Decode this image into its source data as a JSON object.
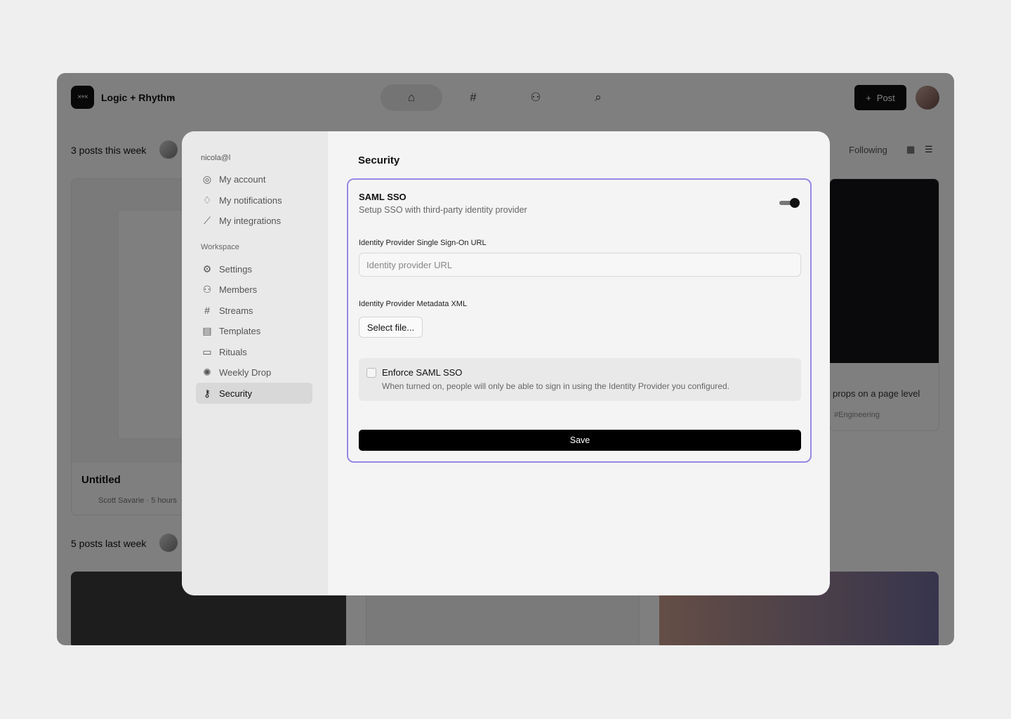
{
  "app": {
    "workspace_name": "Logic + Rhythm",
    "logo_glyph": "×+×",
    "post_button_label": "Post",
    "following_label": "Following",
    "this_week_heading": "3 posts this week",
    "last_week_heading": "5 posts last week",
    "card": {
      "title": "Untitled",
      "meta": "Scott Savarie · 5 hours"
    },
    "right_card": {
      "caption": "props on a page level",
      "tag": "#Engineering"
    }
  },
  "modal": {
    "user_email": "nicola@l",
    "account_items": [
      {
        "label": "My account",
        "icon": "user-circle-icon"
      },
      {
        "label": "My notifications",
        "icon": "bell-icon"
      },
      {
        "label": "My integrations",
        "icon": "plug-icon"
      }
    ],
    "workspace_section_label": "Workspace",
    "workspace_items": [
      {
        "label": "Settings",
        "icon": "gear-icon"
      },
      {
        "label": "Members",
        "icon": "people-icon"
      },
      {
        "label": "Streams",
        "icon": "hash-icon"
      },
      {
        "label": "Templates",
        "icon": "template-icon"
      },
      {
        "label": "Rituals",
        "icon": "calendar-icon"
      },
      {
        "label": "Weekly Drop",
        "icon": "badge-icon"
      },
      {
        "label": "Security",
        "icon": "key-icon",
        "active": true
      }
    ],
    "page_title": "Security",
    "saml": {
      "title": "SAML SSO",
      "subtitle": "Setup SSO with third-party identity provider",
      "enabled": true,
      "url_label": "Identity Provider Single Sign-On URL",
      "url_placeholder": "Identity provider URL",
      "url_value": "",
      "xml_label": "Identity Provider Metadata XML",
      "select_file_label": "Select file...",
      "enforce_title": "Enforce SAML SSO",
      "enforce_description": "When turned on, people will only be able to sign in using the Identity Provider you configured.",
      "enforce_checked": false,
      "save_label": "Save"
    }
  },
  "colors": {
    "accent_border": "#9a86e8",
    "primary_button": "#000000",
    "scrim": "rgba(0,0,0,0.5)"
  }
}
